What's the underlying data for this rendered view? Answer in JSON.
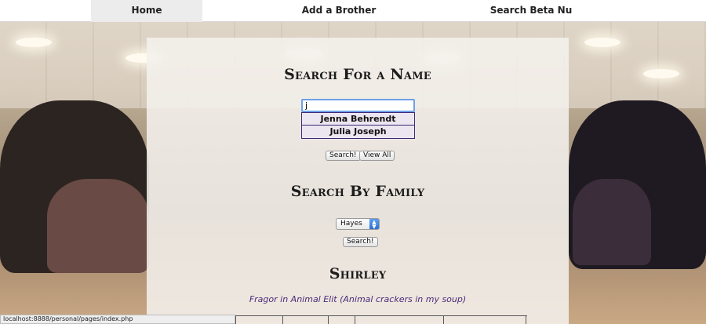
{
  "nav": {
    "items": [
      {
        "label": "Home"
      },
      {
        "label": "Add a Brother"
      },
      {
        "label": "Search Beta Nu"
      }
    ]
  },
  "search_name": {
    "heading": "Search For a Name",
    "input_value": "j",
    "suggestions": [
      "Jenna Behrendt",
      "Julia Joseph"
    ],
    "search_button": "Search!",
    "view_all_button": "View All"
  },
  "search_family": {
    "heading": "Search By Family",
    "selected_family": "Hayes",
    "search_button": "Search!"
  },
  "result": {
    "name": "Shirley",
    "detail": "Fragor in Animal Elit (Animal crackers in my soup)"
  },
  "status_bar": {
    "url": "localhost:8888/personal/pages/index.php"
  }
}
